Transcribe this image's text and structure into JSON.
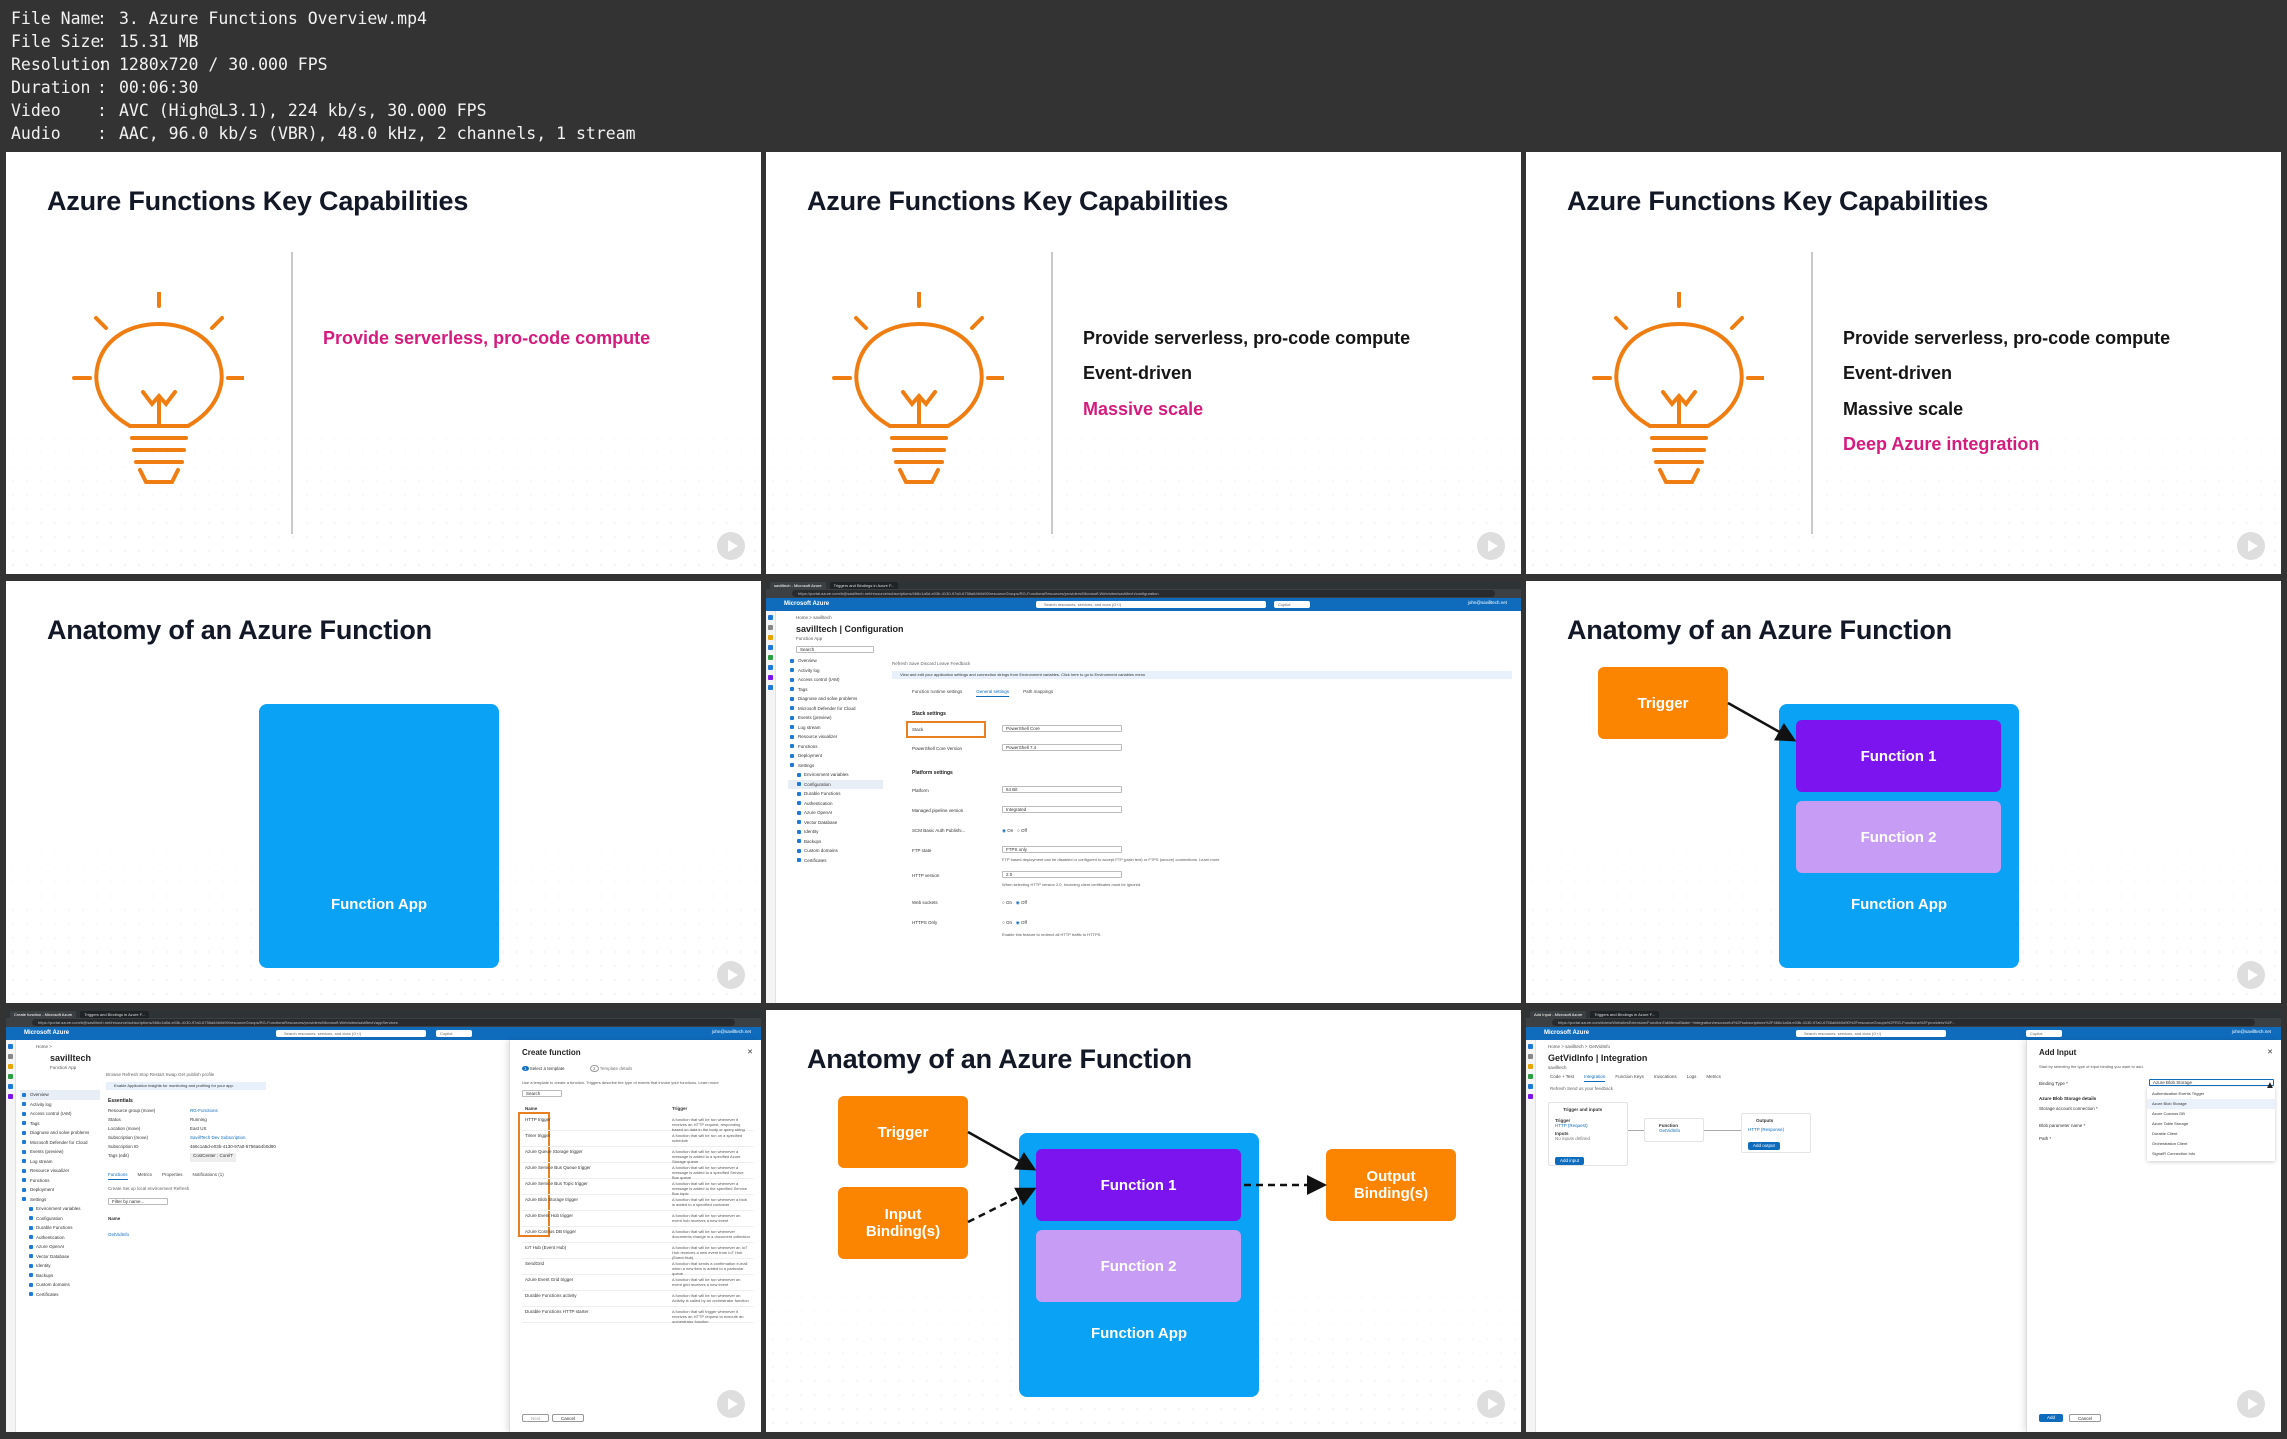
{
  "meta": {
    "rows": [
      {
        "key": "File Name",
        "value": "3. Azure Functions Overview.mp4"
      },
      {
        "key": "File Size",
        "value": "15.31 MB"
      },
      {
        "key": "Resolution",
        "value": "1280x720 / 30.000 FPS"
      },
      {
        "key": "Duration",
        "value": "00:06:30"
      },
      {
        "key": "Video",
        "value": "AVC (High@L3.1), 224 kb/s, 30.000 FPS"
      },
      {
        "key": "Audio",
        "value": "AAC, 96.0 kb/s (VBR), 48.0 kHz, 2 channels, 1 stream"
      }
    ]
  },
  "colors": {
    "highlight": "#d51b7e",
    "orange": "#fb8500",
    "function1": "#7b14ee",
    "function2": "#c79cf5",
    "function_app": "#0aa2f5",
    "azure_bar": "#0f6cbd"
  },
  "capabilities": {
    "title": "Azure Functions Key Capabilities",
    "items": [
      "Provide serverless, pro-code compute",
      "Event-driven",
      "Massive scale",
      "Deep Azure integration"
    ]
  },
  "anatomy": {
    "title": "Anatomy of an Azure Function",
    "function_app": "Function App",
    "trigger": "Trigger",
    "function1": "Function 1",
    "function2": "Function 2",
    "input_binding": "Input Binding(s)",
    "output_binding": "Output Binding(s)"
  },
  "portal": {
    "brand": "Microsoft Azure",
    "search_placeholder": "Search resources, services, and docs (G+/)",
    "copilot": "Copilot",
    "user": "john@savilltech.net",
    "config": {
      "tabs": [
        "savilltech - Microsoft Azure",
        "Triggers and Bindings in Azure F..."
      ],
      "url": "https://portal.azure.com/#@savilltech.net/resource/subscriptions/466c1a5d-e03b-4130-97a0-6756a64b0d90/resourceGroups/RG-FunctionsResources/providers/Microsoft.Web/sites/savilltech/configuration",
      "breadcrumb": "Home > savilltech",
      "title": "savilltech | Configuration",
      "subtitle": "Function App",
      "search": "Search",
      "toolbar": "Refresh    Save    Discard    Leave Feedback",
      "info": "View and edit your application settings and connection strings from Environment variables. Click here to go to Environment variables menu",
      "menu": [
        "Overview",
        "Activity log",
        "Access control (IAM)",
        "Tags",
        "Diagnose and solve problems",
        "Microsoft Defender for Cloud",
        "Events (preview)",
        "Log stream",
        "Resource visualizer",
        "Functions",
        "Deployment",
        "Settings",
        "Environment variables",
        "Configuration",
        "Durable Functions",
        "Authentication",
        "Azure OpenAI",
        "Vector Database",
        "Identity",
        "Backups",
        "Custom domains",
        "Certificates"
      ],
      "page_tabs": [
        "Function runtime settings",
        "General settings",
        "Path mappings"
      ],
      "stack_settings": "Stack settings",
      "stack": "Stack",
      "stack_value": "PowerShell Core",
      "ps_version": "PowerShell Core Version",
      "ps_version_value": "PowerShell 7.4",
      "platform_settings": "Platform settings",
      "platform": "Platform",
      "platform_value": "64 Bit",
      "pipeline": "Managed pipeline version",
      "pipeline_value": "Integrated",
      "scm": "SCM Basic Auth Publishi...",
      "ftp": "FTP state",
      "ftp_value": "FTPS only",
      "ftp_note": "FTP based deployment can be disabled or configured to accept FTP (plain text) or FTPS (secure) connections. Learn more",
      "http": "HTTP version",
      "http_value": "2.0",
      "http_note": "When selecting HTTP version 2.0, incoming client certificates must be ignored.",
      "websockets": "Web sockets",
      "https": "HTTPS Only",
      "https_note": "Enable this feature to redirect all HTTP traffic to HTTPS.",
      "on": "On",
      "off": "Off"
    },
    "create": {
      "tabs": [
        "Create function - Microsoft Azure",
        "Triggers and Bindings in Azure F..."
      ],
      "url": "https://portal.azure.com/#@savilltech.net/resource/subscriptions/466c1a5d-e03b-4130-97a0-6756a64b0d90/resourceGroups/RG-FunctionsResources/providers/Microsoft.Web/sites/savilltech/appServices",
      "breadcrumb": "Home >",
      "title": "savilltech",
      "subtitle": "Function App",
      "toolbar": "Browse   Refresh   Stop   Restart   Swap   Get publish profile",
      "info": "Enable Application Insights for monitoring and profiling for your app.",
      "essentials": "Essentials",
      "fields": [
        {
          "k": "Resource group (move)",
          "v": "RG-Functions"
        },
        {
          "k": "Status",
          "v": "Running"
        },
        {
          "k": "Location (move)",
          "v": "East US"
        },
        {
          "k": "Subscription (move)",
          "v": "SavillTech Dev Subscription"
        },
        {
          "k": "Subscription ID",
          "v": "466c1a5d-e03b-4130-97a0-6756a64b0d90"
        },
        {
          "k": "Tags (edit)",
          "v": "CostCenter : CorelT"
        }
      ],
      "lower_tabs": [
        "Functions",
        "Metrics",
        "Properties",
        "Notifications (1)"
      ],
      "lower_toolbar": "Create    Set up local environment    Refresh",
      "filter": "Filter by name...",
      "name_col": "Name",
      "function_name": "GetVidInfo",
      "blade_title": "Create function",
      "step1": "Select a template",
      "step2": "Template details",
      "blade_desc": "Use a template to create a function. Triggers describe the type of events that invoke your functions. Learn more",
      "search": "Search",
      "col_name": "Name",
      "col_trigger": "Trigger",
      "templates": [
        {
          "n": "HTTP trigger",
          "d": "A function that will be run whenever it receives an HTTP request, responding based on data in the body or query string"
        },
        {
          "n": "Timer trigger",
          "d": "A function that will be run on a specified schedule"
        },
        {
          "n": "Azure Queue Storage trigger",
          "d": "A function that will be run whenever a message is added to a specified Azure Storage queue"
        },
        {
          "n": "Azure Service Bus Queue trigger",
          "d": "A function that will be run whenever a message is added to a specified Service Bus queue"
        },
        {
          "n": "Azure Service Bus Topic trigger",
          "d": "A function that will be run whenever a message is added to the specified Service Bus topic"
        },
        {
          "n": "Azure Blob Storage trigger",
          "d": "A function that will be run whenever a blob is added to a specified container"
        },
        {
          "n": "Azure Event Hub trigger",
          "d": "A function that will be run whenever an event hub receives a new event"
        },
        {
          "n": "Azure Cosmos DB trigger",
          "d": "A function that will be run whenever documents change in a document collection"
        },
        {
          "n": "IoT Hub (Event Hub)",
          "d": "A function that will be run whenever an IoT Hub receives a new event from IoT Hub (Event Hub)"
        },
        {
          "n": "SendGrid",
          "d": "A function that sends a confirmation e-mail when a new item is added to a particular queue"
        },
        {
          "n": "Azure Event Grid trigger",
          "d": "A function that will be run whenever an event grid receives a new event"
        },
        {
          "n": "Durable Functions activity",
          "d": "A function that will be run whenever an Activity is called by an orchestrator function"
        },
        {
          "n": "Durable Functions HTTP starter",
          "d": "A function that will trigger whenever it receives an HTTP request to execute an orchestrator function"
        }
      ],
      "next": "Next",
      "cancel": "Cancel"
    },
    "integration": {
      "tabs": [
        "Add Input - Microsoft Azure",
        "Triggers and Bindings in Azure F..."
      ],
      "url": "https://portal.azure.com/#view/WebsitesExtension/FunctionTabMenuBlade/~/integration/resourceId/%2Fsubscriptions%2F466c1a5d-e03b-4130-97a0-6756a64b0d90%2FresourceGroups%2FRG-Functions%2Fproviders%2F...",
      "breadcrumb": "Home > savilltech > GetVidInfo",
      "title": "GetVidInfo | Integration",
      "subtitle": "savilltech",
      "ptabs": [
        "Code + Test",
        "Integration",
        "Function Keys",
        "Invocations",
        "Logs",
        "Metrics"
      ],
      "toolbar": "Refresh    Send us your feedback",
      "trigger_inputs": "Trigger and inputs",
      "trigger": "Trigger",
      "trigger_value": "HTTP (Request)",
      "inputs": "Inputs",
      "inputs_value": "No inputs defined",
      "add_input": "Add input",
      "function": "Function",
      "function_value": "GetVidInfo",
      "outputs": "Outputs",
      "outputs_value": "HTTP (Response)",
      "add_output": "Add output",
      "blade_title": "Add Input",
      "blade_desc": "Start by selecting the type of input binding you want to add.",
      "binding_type": "Binding Type *",
      "binding_value": "Azure Blob Storage",
      "details": "Azure Blob Storage details",
      "storage_conn": "Storage account connection *",
      "blob_param": "Blob parameter name *",
      "path": "Path *",
      "options": [
        "Authentication Events Trigger",
        "Azure Blob Storage",
        "Azure Cosmos DB",
        "Azure Table Storage",
        "Durable Client",
        "Orchestration Client",
        "SignalR Connection Info"
      ],
      "add": "Add",
      "cancel": "Cancel"
    }
  }
}
